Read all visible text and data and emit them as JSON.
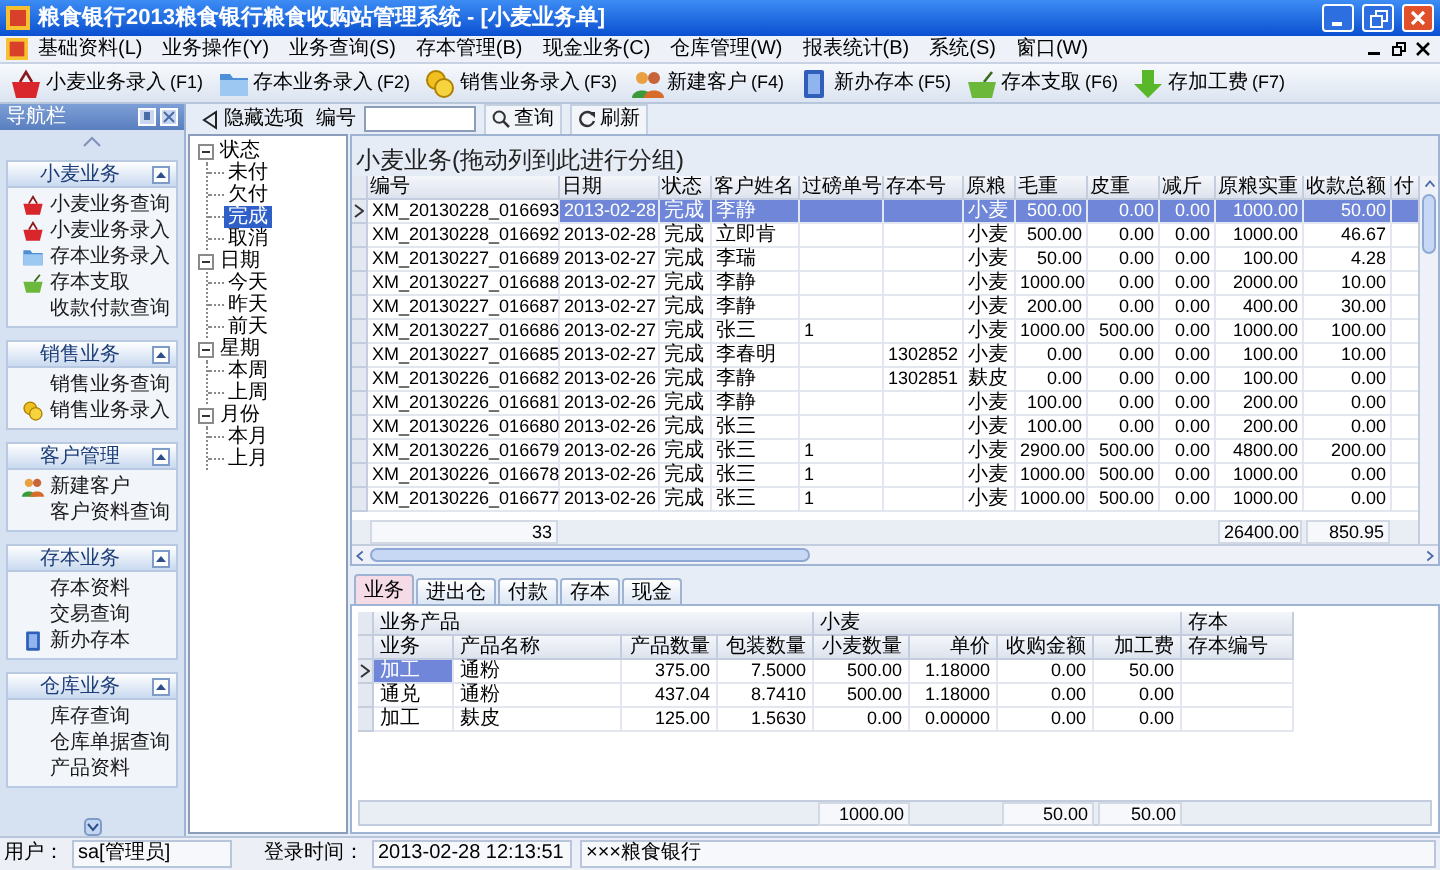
{
  "window": {
    "title": "粮食银行2013粮食银行粮食收购站管理系统 - [小麦业务单]"
  },
  "menu": [
    "基础资料(L)",
    "业务操作(Y)",
    "业务查询(S)",
    "存本管理(B)",
    "现金业务(C)",
    "仓库管理(W)",
    "报表统计(B)",
    "系统(S)",
    "窗口(W)"
  ],
  "toolbar": [
    {
      "label": "小麦业务录入",
      "shortcut": "(F1)",
      "kind": "basket"
    },
    {
      "label": "存本业务录入",
      "shortcut": "(F2)",
      "kind": "folder"
    },
    {
      "label": "销售业务录入",
      "shortcut": "(F3)",
      "kind": "coins"
    },
    {
      "label": "新建客户",
      "shortcut": "(F4)",
      "kind": "people"
    },
    {
      "label": "新办存本",
      "shortcut": "(F5)",
      "kind": "book"
    },
    {
      "label": "存本支取",
      "shortcut": "(F6)",
      "kind": "cart"
    },
    {
      "label": "存加工费",
      "shortcut": "(F7)",
      "kind": "arrow"
    }
  ],
  "nav": {
    "title": "导航栏",
    "groups": [
      {
        "title": "小麦业务",
        "expanded": true,
        "items": [
          {
            "label": "小麦业务查询",
            "kind": "basket"
          },
          {
            "label": "小麦业务录入",
            "kind": "basket"
          },
          {
            "label": "存本业务录入",
            "kind": "folder"
          },
          {
            "label": "存本支取",
            "kind": "cart"
          },
          {
            "label": "收款付款查询",
            "kind": "plain"
          }
        ]
      },
      {
        "title": "销售业务",
        "expanded": true,
        "items": [
          {
            "label": "销售业务查询",
            "kind": "plain"
          },
          {
            "label": "销售业务录入",
            "kind": "coins"
          }
        ]
      },
      {
        "title": "客户管理",
        "expanded": true,
        "items": [
          {
            "label": "新建客户",
            "kind": "people"
          },
          {
            "label": "客户资料查询",
            "kind": "plain"
          }
        ]
      },
      {
        "title": "存本业务",
        "expanded": true,
        "items": [
          {
            "label": "存本资料",
            "kind": "plain"
          },
          {
            "label": "交易查询",
            "kind": "plain"
          },
          {
            "label": "新办存本",
            "kind": "book"
          }
        ]
      },
      {
        "title": "仓库业务",
        "expanded": true,
        "items": [
          {
            "label": "库存查询",
            "kind": "plain"
          },
          {
            "label": "仓库单据查询",
            "kind": "plain"
          },
          {
            "label": "产品资料",
            "kind": "plain"
          }
        ]
      }
    ]
  },
  "tree": [
    {
      "label": "状态",
      "expanded": true,
      "selected": false,
      "children": [
        {
          "label": "未付",
          "selected": false
        },
        {
          "label": "欠付",
          "selected": false
        },
        {
          "label": "完成",
          "selected": true
        },
        {
          "label": "取消",
          "selected": false
        }
      ]
    },
    {
      "label": "日期",
      "expanded": true,
      "selected": false,
      "children": [
        {
          "label": "今天",
          "selected": false
        },
        {
          "label": "昨天",
          "selected": false
        },
        {
          "label": "前天",
          "selected": false
        }
      ]
    },
    {
      "label": "星期",
      "expanded": true,
      "selected": false,
      "children": [
        {
          "label": "本周",
          "selected": false
        },
        {
          "label": "上周",
          "selected": false
        }
      ]
    },
    {
      "label": "月份",
      "expanded": true,
      "selected": false,
      "children": [
        {
          "label": "本月",
          "selected": false
        },
        {
          "label": "上月",
          "selected": false
        }
      ]
    }
  ],
  "filter": {
    "hide_button": "隐藏选项",
    "field_label": "编号",
    "search_button": "查询",
    "refresh_button": "刷新"
  },
  "table": {
    "title": "小麦业务(拖动列到此进行分组)",
    "columns": [
      "编号",
      "日期",
      "状态",
      "客户姓名",
      "过磅单号",
      "存本号",
      "原粮",
      "毛重",
      "皮重",
      "减斤",
      "原粮实重",
      "收款总额",
      "付"
    ],
    "rows": [
      {
        "selected": true,
        "id": "XM_20130228_016693",
        "date": "2013-02-28",
        "status": "完成",
        "customer": "李静",
        "grain": "小麦",
        "gross": "500.00",
        "tare": "0.00",
        "deduct": "0.00",
        "net": "1000.00",
        "received": "50.00"
      },
      {
        "selected": false,
        "id": "XM_20130228_016692",
        "date": "2013-02-28",
        "status": "完成",
        "customer": "立即肯",
        "grain": "小麦",
        "gross": "500.00",
        "tare": "0.00",
        "deduct": "0.00",
        "net": "1000.00",
        "received": "46.67"
      },
      {
        "selected": false,
        "id": "XM_20130227_016689",
        "date": "2013-02-27",
        "status": "完成",
        "customer": "李瑞",
        "grain": "小麦",
        "gross": "50.00",
        "tare": "0.00",
        "deduct": "0.00",
        "net": "100.00",
        "received": "4.28"
      },
      {
        "selected": false,
        "id": "XM_20130227_016688",
        "date": "2013-02-27",
        "status": "完成",
        "customer": "李静",
        "grain": "小麦",
        "gross": "1000.00",
        "tare": "0.00",
        "deduct": "0.00",
        "net": "2000.00",
        "received": "10.00"
      },
      {
        "selected": false,
        "id": "XM_20130227_016687",
        "date": "2013-02-27",
        "status": "完成",
        "customer": "李静",
        "grain": "小麦",
        "gross": "200.00",
        "tare": "0.00",
        "deduct": "0.00",
        "net": "400.00",
        "received": "30.00"
      },
      {
        "selected": false,
        "id": "XM_20130227_016686",
        "date": "2013-02-27",
        "status": "完成",
        "customer": "张三",
        "weigh_no": "1",
        "grain": "小麦",
        "gross": "1000.00",
        "tare": "500.00",
        "deduct": "0.00",
        "net": "1000.00",
        "received": "100.00"
      },
      {
        "selected": false,
        "id": "XM_20130227_016685",
        "date": "2013-02-27",
        "status": "完成",
        "customer": "李春明",
        "deposit_no": "1302852",
        "grain": "小麦",
        "gross": "0.00",
        "tare": "0.00",
        "deduct": "0.00",
        "net": "100.00",
        "received": "10.00"
      },
      {
        "selected": false,
        "id": "XM_20130226_016682",
        "date": "2013-02-26",
        "status": "完成",
        "customer": "李静",
        "deposit_no": "1302851",
        "grain": "麸皮",
        "gross": "0.00",
        "tare": "0.00",
        "deduct": "0.00",
        "net": "100.00",
        "received": "0.00"
      },
      {
        "selected": false,
        "id": "XM_20130226_016681",
        "date": "2013-02-26",
        "status": "完成",
        "customer": "李静",
        "grain": "小麦",
        "gross": "100.00",
        "tare": "0.00",
        "deduct": "0.00",
        "net": "200.00",
        "received": "0.00"
      },
      {
        "selected": false,
        "id": "XM_20130226_016680",
        "date": "2013-02-26",
        "status": "完成",
        "customer": "张三",
        "grain": "小麦",
        "gross": "100.00",
        "tare": "0.00",
        "deduct": "0.00",
        "net": "200.00",
        "received": "0.00"
      },
      {
        "selected": false,
        "id": "XM_20130226_016679",
        "date": "2013-02-26",
        "status": "完成",
        "customer": "张三",
        "weigh_no": "1",
        "grain": "小麦",
        "gross": "2900.00",
        "tare": "500.00",
        "deduct": "0.00",
        "net": "4800.00",
        "received": "200.00"
      },
      {
        "selected": false,
        "id": "XM_20130226_016678",
        "date": "2013-02-26",
        "status": "完成",
        "customer": "张三",
        "weigh_no": "1",
        "grain": "小麦",
        "gross": "1000.00",
        "tare": "500.00",
        "deduct": "0.00",
        "net": "1000.00",
        "received": "0.00"
      },
      {
        "selected": false,
        "id": "XM_20130226_016677",
        "date": "2013-02-26",
        "status": "完成",
        "customer": "张三",
        "weigh_no": "1",
        "grain": "小麦",
        "gross": "1000.00",
        "tare": "500.00",
        "deduct": "0.00",
        "net": "1000.00",
        "received": "0.00"
      }
    ],
    "footer": {
      "count": "33",
      "net_total": "26400.00",
      "received_total": "850.95"
    }
  },
  "detail_tabs": [
    {
      "label": "业务",
      "selected": true
    },
    {
      "label": "进出仓",
      "selected": false
    },
    {
      "label": "付款",
      "selected": false
    },
    {
      "label": "存本",
      "selected": false
    },
    {
      "label": "现金",
      "selected": false
    }
  ],
  "detail": {
    "groups": [
      "业务产品",
      "小麦",
      "存本"
    ],
    "columns": [
      "业务",
      "产品名称",
      "产品数量",
      "包装数量",
      "小麦数量",
      "单价",
      "收购金额",
      "加工费",
      "存本编号"
    ],
    "rows": [
      {
        "selected": true,
        "business": "加工",
        "product": "通粉",
        "product_qty": "375.00",
        "package_qty": "7.5000",
        "wheat_qty": "500.00",
        "unit_price": "1.18000",
        "purchase_amount": "0.00",
        "processing_fee": "50.00"
      },
      {
        "selected": false,
        "business": "通兑",
        "product": "通粉",
        "product_qty": "437.04",
        "package_qty": "8.7410",
        "wheat_qty": "500.00",
        "unit_price": "1.18000",
        "purchase_amount": "0.00",
        "processing_fee": "0.00"
      },
      {
        "selected": false,
        "business": "加工",
        "product": "麸皮",
        "product_qty": "125.00",
        "package_qty": "1.5630",
        "wheat_qty": "0.00",
        "unit_price": "0.00000",
        "purchase_amount": "0.00",
        "processing_fee": "0.00"
      }
    ],
    "footer": {
      "wheat_qty": "1000.00",
      "purchase_amount": "50.00",
      "processing_fee": "50.00"
    }
  },
  "status_bar": {
    "user_label": "用户：",
    "user": "sa[管理员]",
    "login_label": "登录时间：",
    "login_time": "2013-02-28 12:13:51",
    "org": "×××粮食银行"
  }
}
